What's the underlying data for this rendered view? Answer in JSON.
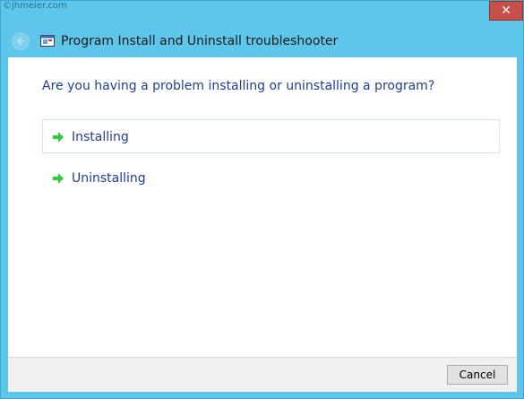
{
  "watermark": "©jhmeier.com",
  "titlebar": {
    "close_label": "✕",
    "back_icon": "back-arrow-icon",
    "app_icon": "troubleshooter-icon"
  },
  "header": {
    "title": "Program Install and Uninstall troubleshooter"
  },
  "main": {
    "question": "Are you having a problem installing or uninstalling a program?",
    "options": [
      {
        "label": "Installing",
        "icon": "green-arrow-icon",
        "selected": true
      },
      {
        "label": "Uninstalling",
        "icon": "green-arrow-icon",
        "selected": false
      }
    ]
  },
  "footer": {
    "cancel_label": "Cancel"
  },
  "colors": {
    "chrome": "#5ec6ea",
    "close": "#c7504a",
    "link_text": "#1f3d99",
    "arrow": "#2ecc40"
  }
}
